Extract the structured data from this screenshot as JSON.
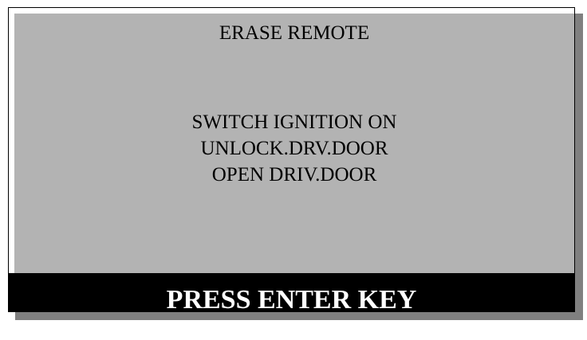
{
  "screen": {
    "title": "ERASE REMOTE",
    "instructions": [
      "SWITCH IGNITION ON",
      "UNLOCK.DRV.DOOR",
      "OPEN DRIV.DOOR"
    ]
  },
  "footer": {
    "prompt": "PRESS ENTER KEY"
  },
  "colors": {
    "screen_background": "#b3b3b3",
    "footer_background": "#000000",
    "footer_text": "#ffffff",
    "shadow": "#808080"
  }
}
